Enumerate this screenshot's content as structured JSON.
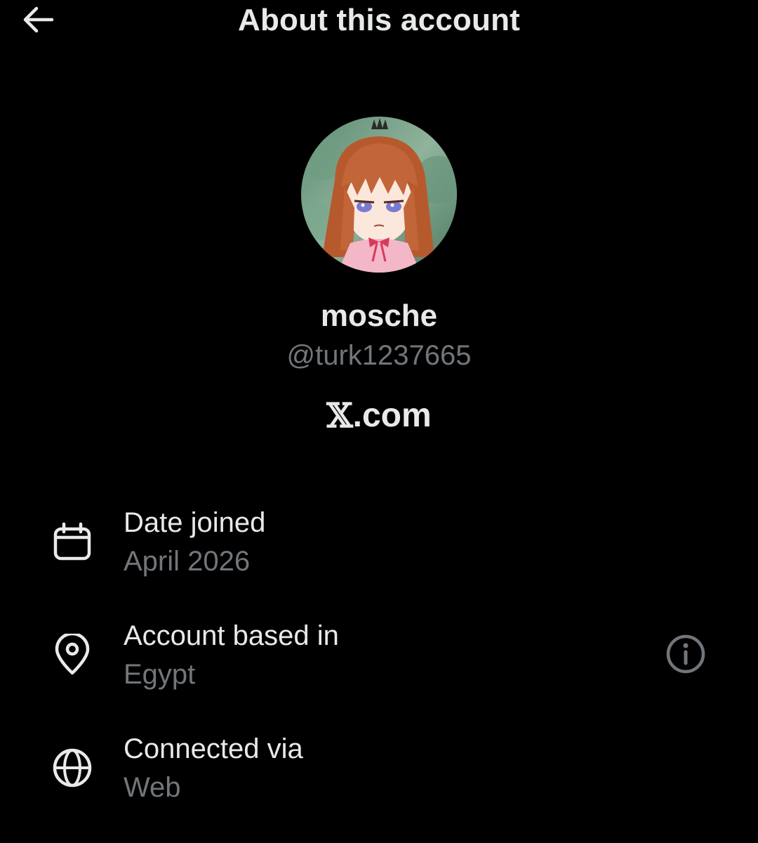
{
  "header": {
    "title": "About this account",
    "back_icon": "arrow-left-icon"
  },
  "profile": {
    "display_name": "mosche",
    "handle": "@turk1237665",
    "avatar": "anime-girl-avatar",
    "platform_logo": "𝕏",
    "platform_suffix": ".com"
  },
  "details": [
    {
      "icon": "calendar-icon",
      "label": "Date joined",
      "value": "April 2026"
    },
    {
      "icon": "location-pin-icon",
      "label": "Account based in",
      "value": "Egypt",
      "action_icon": "info-icon"
    },
    {
      "icon": "globe-icon",
      "label": "Connected via",
      "value": "Web"
    }
  ],
  "colors": {
    "background": "#000000",
    "primary_text": "#e7e9ea",
    "secondary_text": "#71767b"
  }
}
